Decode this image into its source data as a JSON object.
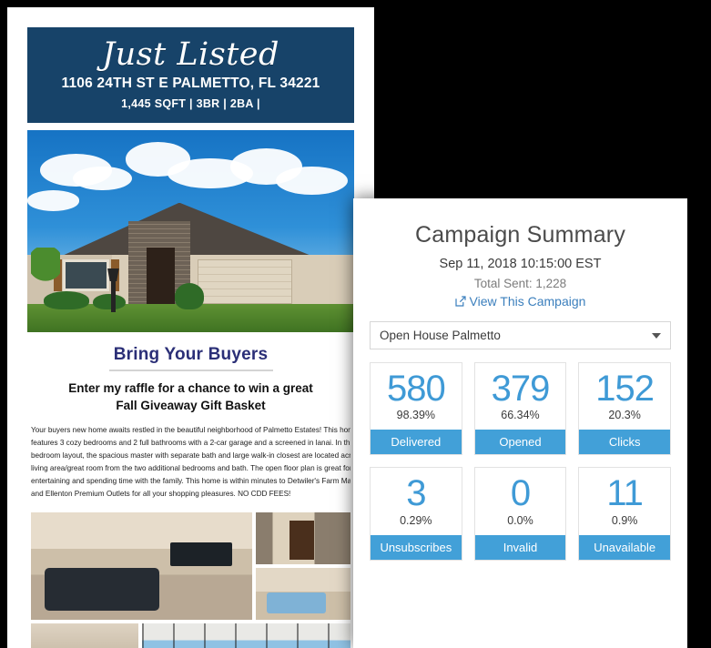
{
  "flyer": {
    "banner": {
      "headline": "Just Listed",
      "address": "1106 24TH ST E PALMETTO, FL 34221",
      "specs": "1,445 SQFT | 3BR | 2BA |"
    },
    "hero_photo_alt": "house-exterior-photo",
    "body": {
      "heading": "Bring Your Buyers",
      "subheading_line1": "Enter my raffle for a chance to win a great",
      "subheading_line2": "Fall Giveaway Gift Basket",
      "paragraph_lines": [
        "Your buyers new home awaits restled in the beautiful neighborhood of Palmetto Estates! This home",
        "features 3 cozy bedrooms and 2 full bathrooms with a 2-car garage and a screened in lanai. In this sp",
        "bedroom layout, the spacious master with separate bath and large walk-in closest are located across",
        "living area/great room from the two additional bedrooms and bath. The open floor plan is great for",
        "entertaining and spending time with the family. This home is within minutes to Detwiler's Farm Mark",
        "and Ellenton Premium Outlets for all your shopping pleasures. NO CDD FEES!"
      ]
    },
    "photos": [
      "living-room-photo",
      "front-entry-photo",
      "master-bedroom-photo",
      "bathroom-photo",
      "lanai-photo"
    ]
  },
  "panel": {
    "title": "Campaign Summary",
    "date": "Sep 11, 2018 10:15:00 EST",
    "total_sent": "Total Sent: 1,228",
    "view_link": "View This Campaign",
    "view_link_icon": "external-link-icon",
    "campaign_select": {
      "value": "Open House Palmetto",
      "caret_icon": "chevron-down-icon"
    },
    "accent_color": "#42a0d8",
    "number_color": "#3f9ad6",
    "stats": [
      {
        "value": "580",
        "percent": "98.39%",
        "label": "Delivered"
      },
      {
        "value": "379",
        "percent": "66.34%",
        "label": "Opened"
      },
      {
        "value": "152",
        "percent": "20.3%",
        "label": "Clicks"
      },
      {
        "value": "3",
        "percent": "0.29%",
        "label": "Unsubscribes"
      },
      {
        "value": "0",
        "percent": "0.0%",
        "label": "Invalid"
      },
      {
        "value": "11",
        "percent": "0.9%",
        "label": "Unavailable"
      }
    ]
  }
}
